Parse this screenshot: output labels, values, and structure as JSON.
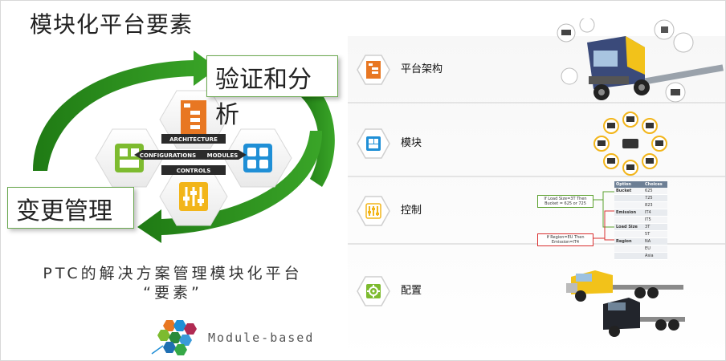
{
  "title": "模块化平台要素",
  "cycle": {
    "analysis_label": "验证和分析",
    "change_label": "变更管理",
    "hex_labels": {
      "architecture": "ARCHITECTURE",
      "configurations": "CONFIGURATIONS",
      "modules": "MODULES",
      "controls": "CONTROLS"
    }
  },
  "bottom_text": {
    "line1": "PTC的解决方案管理模块化平台",
    "line2": "“要素”"
  },
  "module_label": "Module-based",
  "rows": [
    {
      "label": "平台架构",
      "icon": "architecture-icon"
    },
    {
      "label": "模块",
      "icon": "modules-icon"
    },
    {
      "label": "控制",
      "icon": "controls-icon"
    },
    {
      "label": "配置",
      "icon": "configuration-icon"
    }
  ],
  "option_table": {
    "headers": [
      "Option",
      "Choices"
    ],
    "rows": [
      [
        "Bucket",
        "625"
      ],
      [
        "",
        "725"
      ],
      [
        "",
        "823"
      ],
      [
        "Emission",
        "IT4"
      ],
      [
        "",
        "IT5"
      ],
      [
        "Load Size",
        "3T"
      ],
      [
        "",
        "5T"
      ],
      [
        "Region",
        "NA"
      ],
      [
        "",
        "EU"
      ],
      [
        "",
        "Asia"
      ]
    ]
  },
  "rules": {
    "green": "If Load Size=3T Then Bucket = 625 or 725",
    "red": "If Region=EU Then Emission=IT4"
  },
  "colors": {
    "arrow_green": "#2e8b1e",
    "hex_orange": "#e87722",
    "hex_green": "#7dbb2f",
    "hex_blue": "#1f8fd6",
    "hex_yellow": "#f2b51a"
  }
}
